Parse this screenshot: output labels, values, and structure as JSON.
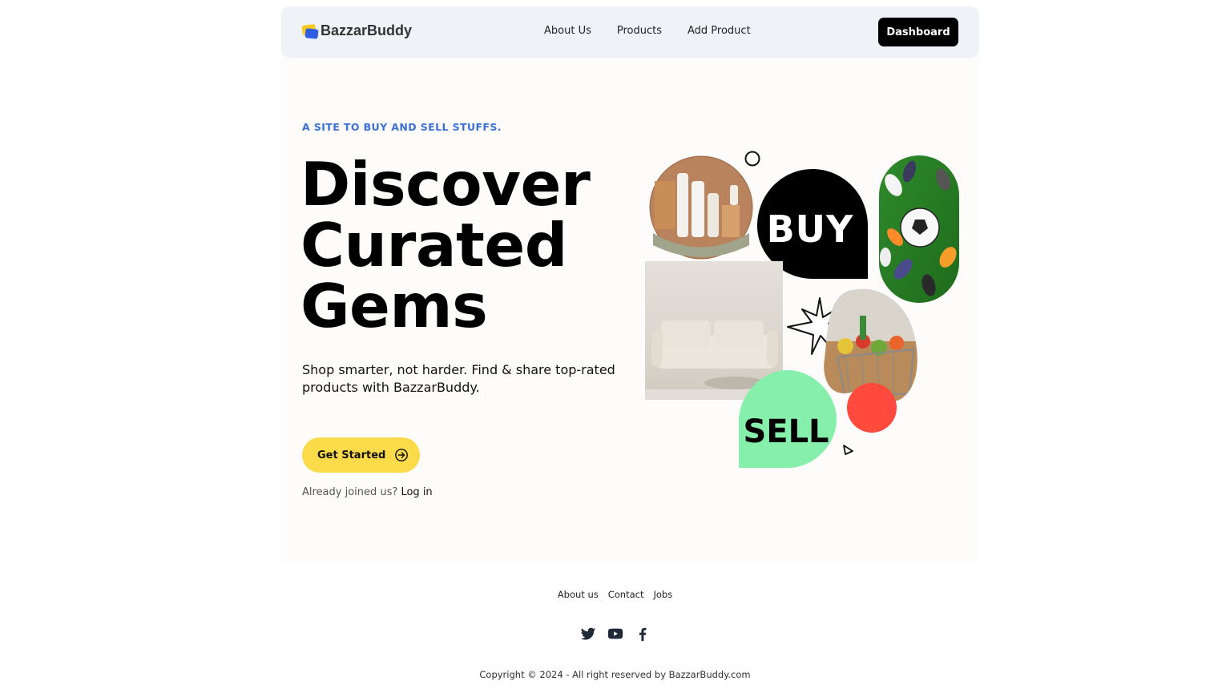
{
  "brand": {
    "name": "BazzarBuddy"
  },
  "nav": {
    "links": [
      "About Us",
      "Products",
      "Add Product"
    ],
    "dashboard_label": "Dashboard"
  },
  "hero": {
    "tagline": "A SITE TO BUY AND SELL STUFFS.",
    "headline": [
      "Discover",
      "Curated",
      "Gems"
    ],
    "subtext": "Shop smarter, not harder. Find & share top-rated products with BazzarBuddy.",
    "cta_label": "Get Started",
    "login_prompt": "Already joined us?",
    "login_link": "Log in",
    "collage": {
      "buy_label": "BUY",
      "sell_label": "SELL"
    }
  },
  "footer": {
    "links": [
      "About us",
      "Contact",
      "Jobs"
    ],
    "social": [
      "twitter-icon",
      "youtube-icon",
      "facebook-icon"
    ],
    "copyright": "Copyright © 2024 - All right reserved by BazzarBuddy.com"
  },
  "colors": {
    "accent_blue": "#3b6fd8",
    "cta_yellow": "#fbdb4a",
    "sell_green": "#86efac",
    "dot_red": "#ff4a3d"
  }
}
